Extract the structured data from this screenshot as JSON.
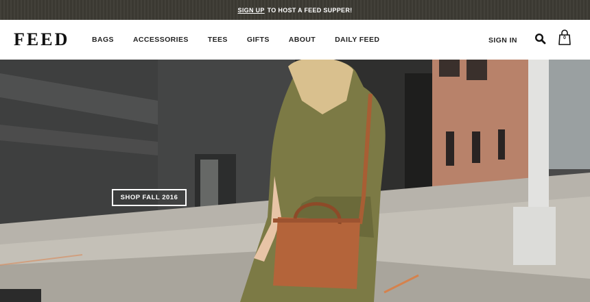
{
  "promo": {
    "link_text": "SIGN UP",
    "rest_text": "TO HOST A FEED SUPPER!"
  },
  "header": {
    "logo_text": "FEED",
    "menu": [
      {
        "label": "BAGS"
      },
      {
        "label": "ACCESSORIES"
      },
      {
        "label": "TEES"
      },
      {
        "label": "GIFTS"
      },
      {
        "label": "ABOUT"
      },
      {
        "label": "DAILY FEED"
      }
    ],
    "sign_in_label": "SIGN IN",
    "cart_count": "0",
    "icons": {
      "search": "search-icon",
      "cart": "shopping-bag-icon"
    }
  },
  "hero": {
    "cta_label": "SHOP FALL 2016",
    "image_subject": "woman-in-olive-jacket-with-tan-leather-bag"
  },
  "colors": {
    "promo_bg": "#3d3b34",
    "nav_bg": "#ffffff",
    "text_dark": "#222222",
    "cta_border": "#ffffff"
  }
}
